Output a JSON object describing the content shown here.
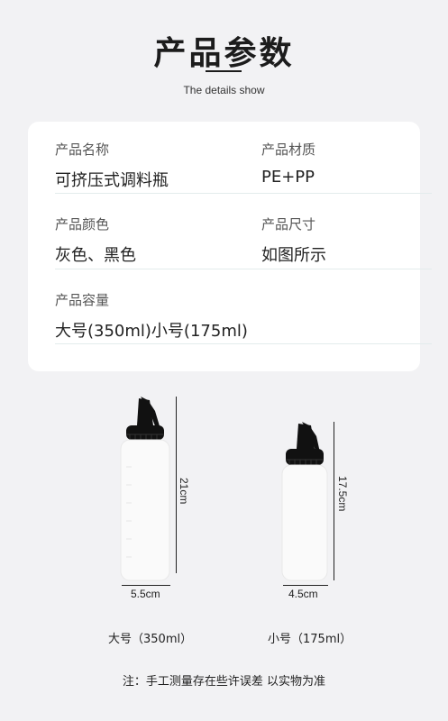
{
  "header": {
    "title": "产品参数",
    "subtitle": "The details show"
  },
  "params": [
    {
      "label": "产品名称",
      "value": "可挤压式调料瓶"
    },
    {
      "label": "产品材质",
      "value": "PE+PP"
    },
    {
      "label": "产品颜色",
      "value": "灰色、黑色"
    },
    {
      "label": "产品尺寸",
      "value": "如图所示"
    },
    {
      "label": "产品容量",
      "value": "大号(350ml)小号(175ml)"
    }
  ],
  "bottles": {
    "large": {
      "height": "21cm",
      "width": "5.5cm",
      "caption": "大号（350ml）"
    },
    "small": {
      "height": "17.5cm",
      "width": "4.5cm",
      "caption": "小号（175ml）"
    }
  },
  "footer": {
    "note": "注：手工测量存在些许误差 以实物为准"
  },
  "colors": {
    "background": "#f2f2f4",
    "card": "#ffffff",
    "divider": "#e3ecec",
    "cap": "#111111"
  }
}
